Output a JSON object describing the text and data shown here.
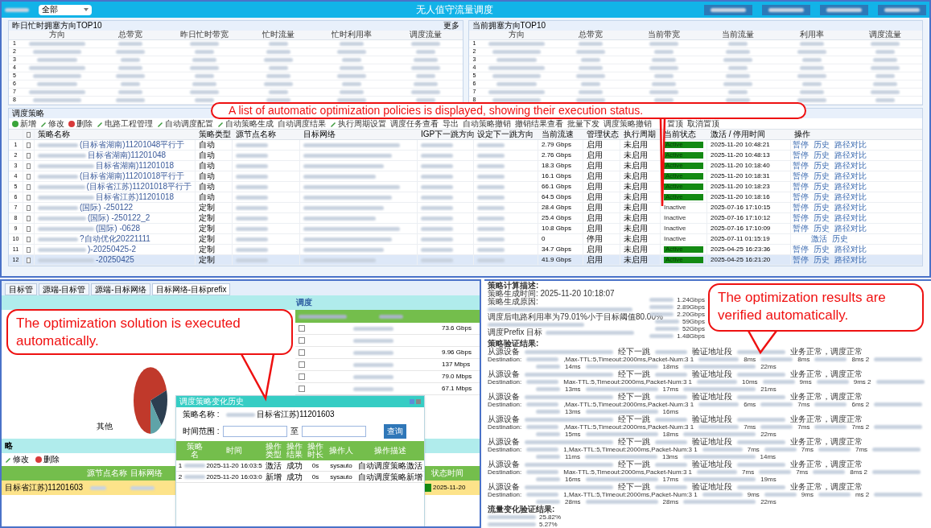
{
  "header": {
    "plane_select": "全部",
    "title": "无人值守流量调度"
  },
  "top_tables": [
    {
      "title": "昨日忙时拥塞方向TOP10",
      "more": "更多",
      "columns": [
        "方向",
        "总带宽",
        "昨日忙时带宽",
        "忙时流量",
        "忙时利用率",
        "调度流量"
      ],
      "rows": [
        "1",
        "2",
        "3",
        "4",
        "5",
        "6",
        "7",
        "8"
      ]
    },
    {
      "title": "当前拥塞方向TOP10",
      "columns": [
        "方向",
        "总带宽",
        "当前带宽",
        "当前流量",
        "利用率",
        "调度流量"
      ],
      "rows": [
        "1",
        "2",
        "3",
        "4",
        "5",
        "6",
        "7",
        "8"
      ]
    }
  ],
  "policies": {
    "title": "调度策略",
    "toolbar": [
      {
        "label": "新增",
        "kind": "add"
      },
      {
        "label": "修改",
        "kind": "edit"
      },
      {
        "label": "删除",
        "kind": "delete"
      },
      {
        "label": "电路工程管理",
        "kind": "edit"
      },
      {
        "label": "自动调度配置",
        "kind": "edit"
      },
      {
        "label": "自动策略生成",
        "kind": "edit"
      },
      {
        "label": "自动调度结果",
        "kind": "plain"
      },
      {
        "label": "执行周期设置",
        "kind": "edit"
      },
      {
        "label": "调度任务查看",
        "kind": "plain"
      },
      {
        "label": "导出",
        "kind": "plain"
      },
      {
        "label": "自动策略撤销",
        "kind": "plain"
      },
      {
        "label": "撤销结果查看",
        "kind": "plain"
      },
      {
        "label": "批量下发",
        "kind": "plain"
      },
      {
        "label": "调度策略撤销",
        "kind": "plain"
      },
      {
        "label": "置顶",
        "kind": "plain"
      },
      {
        "label": "取消置顶",
        "kind": "plain"
      }
    ],
    "all_checked": false,
    "columns": [
      "策略名称",
      "策略类型",
      "源节点名称",
      "目标网络",
      "IGP下一跳方向",
      "设定下一跳方向",
      "当前流速",
      "管理状态",
      "执行周期",
      "当前状态",
      "激活 / 停用时间",
      "操作"
    ],
    "rows": [
      {
        "num": "1",
        "checked": false,
        "name": "(目标省湖南)11201048平行于",
        "type": "自动",
        "speed": "2.79 Gbps",
        "mgmt": "启用",
        "cycle": "未启用",
        "status": "Active",
        "active": true,
        "time": "2025-11-20 10:48:21",
        "actions": [
          "暂停",
          "历史",
          "路径对比"
        ],
        "selected": false
      },
      {
        "num": "2",
        "checked": false,
        "name": "目标省湖南)11201048",
        "type": "自动",
        "speed": "2.76 Gbps",
        "mgmt": "启用",
        "cycle": "未启用",
        "status": "Active",
        "active": true,
        "time": "2025-11-20 10:48:13",
        "actions": [
          "暂停",
          "历史",
          "路径对比"
        ],
        "selected": false
      },
      {
        "num": "3",
        "checked": false,
        "name": "目标省湖南)11201018",
        "type": "自动",
        "speed": "18.3 Gbps",
        "mgmt": "启用",
        "cycle": "未启用",
        "status": "Active",
        "active": true,
        "time": "2025-11-20 10:18:40",
        "actions": [
          "暂停",
          "历史",
          "路径对比"
        ],
        "selected": false
      },
      {
        "num": "4",
        "checked": false,
        "name": "(目标省湖南)11201018平行于",
        "type": "自动",
        "speed": "16.1 Gbps",
        "mgmt": "启用",
        "cycle": "未启用",
        "status": "Active",
        "active": true,
        "time": "2025-11-20 10:18:31",
        "actions": [
          "暂停",
          "历史",
          "路径对比"
        ],
        "selected": false
      },
      {
        "num": "5",
        "checked": false,
        "name": "(目标省江苏)11201018平行于",
        "type": "自动",
        "speed": "66.1 Gbps",
        "mgmt": "启用",
        "cycle": "未启用",
        "status": "Active",
        "active": true,
        "time": "2025-11-20 10:18:23",
        "actions": [
          "暂停",
          "历史",
          "路径对比"
        ],
        "selected": false
      },
      {
        "num": "6",
        "checked": false,
        "name": "目标省江苏)11201018",
        "type": "自动",
        "speed": "64.5 Gbps",
        "mgmt": "启用",
        "cycle": "未启用",
        "status": "Active",
        "active": true,
        "time": "2025-11-20 10:18:16",
        "actions": [
          "暂停",
          "历史",
          "路径对比"
        ],
        "selected": false
      },
      {
        "num": "7",
        "checked": false,
        "name": "(国际) -250122",
        "type": "定制",
        "speed": "28.4 Gbps",
        "mgmt": "启用",
        "cycle": "未启用",
        "status": "Inactive",
        "active": false,
        "time": "2025-07-16 17:10:15",
        "actions": [
          "暂停",
          "历史",
          "路径对比"
        ],
        "selected": false
      },
      {
        "num": "8",
        "checked": false,
        "name": "(国际) -250122_2",
        "type": "定制",
        "speed": "25.4 Gbps",
        "mgmt": "启用",
        "cycle": "未启用",
        "status": "Inactive",
        "active": false,
        "time": "2025-07-16 17:10:12",
        "actions": [
          "暂停",
          "历史",
          "路径对比"
        ],
        "selected": false
      },
      {
        "num": "9",
        "checked": false,
        "name": "(国际) -0628",
        "type": "定制",
        "speed": "10.8 Gbps",
        "mgmt": "启用",
        "cycle": "未启用",
        "status": "Inactive",
        "active": false,
        "time": "2025-07-16 17:10:09",
        "actions": [
          "暂停",
          "历史",
          "路径对比"
        ],
        "selected": false
      },
      {
        "num": "10",
        "checked": false,
        "name": "?自动优化20221111",
        "type": "定制",
        "speed": "0",
        "mgmt": "停用",
        "cycle": "未启用",
        "status": "Inactive",
        "active": false,
        "time": "2025-07-11 01:15:19",
        "actions": [
          "激活",
          "历史"
        ],
        "selected": false
      },
      {
        "num": "11",
        "checked": false,
        "name": ")-20250425-2",
        "type": "定制",
        "speed": "34.7 Gbps",
        "mgmt": "启用",
        "cycle": "未启用",
        "status": "Active",
        "active": true,
        "time": "2025-04-25 16:23:36",
        "actions": [
          "暂停",
          "历史",
          "路径对比"
        ],
        "selected": false
      },
      {
        "num": "12",
        "checked": false,
        "name": "-20250425",
        "type": "定制",
        "speed": "41.9 Gbps",
        "mgmt": "启用",
        "cycle": "未启用",
        "status": "Active",
        "active": true,
        "time": "2025-04-25 16:21:20",
        "actions": [
          "暂停",
          "历史",
          "路径对比"
        ],
        "selected": true
      }
    ]
  },
  "dispatch": {
    "tabs": [
      {
        "label": "目标管",
        "selected": false
      },
      {
        "label": "源端-目标管",
        "selected": false
      },
      {
        "label": "源端-目标网络",
        "selected": false
      },
      {
        "label": "目标网络-目标prefix",
        "selected": true
      }
    ],
    "section_title": "调度",
    "pie_label": "其他",
    "flow_rows": [
      {
        "checked": false,
        "value": "73.6 Gbps"
      },
      {
        "checked": false
      },
      {
        "checked": false,
        "value": "9.96 Gbps"
      },
      {
        "checked": false,
        "value": "137 Mbps"
      },
      {
        "checked": false,
        "value": "79.0 Mbps"
      },
      {
        "checked": false,
        "value": "67.1 Mbps"
      }
    ],
    "policy_title": "略",
    "policy_toolbar": [
      {
        "label": "修改",
        "kind": "edit"
      },
      {
        "label": "删除",
        "kind": "delete"
      }
    ],
    "policy_columns": [
      "源节点名称",
      "目标网络"
    ],
    "policy_status_column": "状态时间",
    "policy_row": {
      "name": "目标省江苏)11201603",
      "active": true,
      "time": "2025-11-20"
    },
    "dialog": {
      "title": "调度策略变化历史",
      "name_label": "策略名称 :",
      "name_value": "目标省江苏)11201603",
      "range_label": "时间范围 :",
      "range_to": "至",
      "query": "查询",
      "columns": [
        "策略名",
        "时间",
        "操作类型",
        "操作结果",
        "操作时长",
        "操作人",
        "操作描述"
      ],
      "rows": [
        {
          "num": "1",
          "time": "2025-11-20 16:03:5",
          "op": "激活",
          "result": "成功",
          "dur": "0s",
          "user": "sysauto",
          "desc": "自动调度策略激活"
        },
        {
          "num": "2",
          "time": "2025-11-20 16:03:0",
          "op": "新增",
          "result": "成功",
          "dur": "0s",
          "user": "sysauto",
          "desc": "自动调度策略新增"
        }
      ]
    }
  },
  "report": {
    "heading": "策略计算描述:",
    "gen_time": "策略生成时间: 2025-11-20 10:18:07",
    "reason": "策略生成原因:",
    "after": "调度后电路利用率为79.01%小于目标阈值80.00%",
    "prefix": "调度Prefix 目标",
    "rates": [
      "1.24Gbps",
      "2.89Gbps",
      "2.20Gbps",
      "59Gbps",
      "52Gbps",
      "1.48Gbps"
    ],
    "verify_heading": "策略验证结果:",
    "blocks": [
      {
        "src": "从源设备",
        "hop": "经下一跳",
        "addr": "验证地址段",
        "result": "业务正常，调度正常",
        "dest": "Destination:",
        "params": ",Max-TTL:5,Timeout:2000ms,Packet-Num:3 1",
        "hops": [
          "8ms",
          "8ms",
          "8ms 2"
        ],
        "rtts": [
          "14ms",
          "18ms",
          "22ms"
        ]
      },
      {
        "src": "从源设备",
        "hop": "经下一跳",
        "addr": "验证地址段",
        "result": "业务正常，调度正常",
        "dest": "Destination:",
        "params": "Max-TTL:5,Timeout:2000ms,Packet-Num:3 1",
        "hops": [
          "10ms",
          "9ms",
          "9ms 2"
        ],
        "rtts": [
          "13ms",
          "17ms",
          "21ms"
        ]
      },
      {
        "src": "从源设备",
        "hop": "经下一跳",
        "addr": "验证地址段",
        "result": "业务正常，调度正常",
        "dest": "Destination:",
        "params": ",Max-TTL:5,Timeout:2000ms,Packet-Num:3 1",
        "hops": [
          "6ms",
          "7ms",
          "6ms 2"
        ],
        "rtts": [
          "13ms",
          "16ms"
        ]
      },
      {
        "src": "从源设备",
        "hop": "经下一跳",
        "addr": "验证地址段",
        "result": "业务正常，调度正常",
        "dest": "Destination:",
        "params": ",Max-TTL:5,Timeout:2000ms,Packet-Num:3 1",
        "hops": [
          "7ms",
          "7ms",
          "7ms 2"
        ],
        "rtts": [
          "15ms",
          "18ms",
          "22ms"
        ]
      },
      {
        "src": "从源设备",
        "hop": "经下一跳",
        "addr": "验证地址段",
        "result": "业务正常，调度正常",
        "dest": "Destination:",
        "params": "1,Max-TTL:5,Timeout:2000ms,Packet-Num:3 1",
        "hops": [
          "7ms",
          "7ms",
          "7ms"
        ],
        "rtts": [
          "11ms",
          "13ms",
          "14ms"
        ]
      },
      {
        "src": "从源设备",
        "hop": "经下一跳",
        "addr": "验证地址段",
        "result": "业务正常，调度正常",
        "dest": "Destination:",
        "params": "Max-TTL:5,Timeout:2000ms,Packet-Num:3 1",
        "hops": [
          "7ms",
          "7ms",
          "8ms 2"
        ],
        "rtts": [
          "16ms",
          "17ms",
          "19ms"
        ]
      },
      {
        "src": "从源设备",
        "hop": "经下一跳",
        "addr": "验证地址段",
        "result": "业务正常，调度正常",
        "dest": "Destination:",
        "params": "1,Max-TTL:5,Timeout:2000ms,Packet-Num:3 1",
        "hops": [
          "9ms",
          "9ms",
          "ms 2"
        ],
        "rtts": [
          "28ms",
          "28ms",
          "22ms"
        ]
      }
    ],
    "traffic_heading": "流量变化验证结果:",
    "traffic": [
      "25.82%",
      "5.27%"
    ]
  },
  "callouts": [
    {
      "text": "A list of automatic optimization policies is displayed, showing their execution status."
    },
    {
      "text": "The optimization solution is executed automatically."
    },
    {
      "text": "The optimization results are verified automatically."
    }
  ]
}
